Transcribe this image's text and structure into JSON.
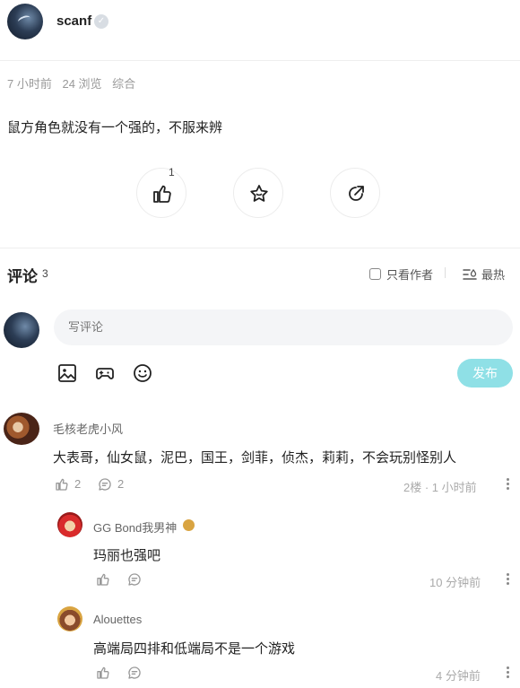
{
  "post": {
    "author": "scanf",
    "time_ago": "7 小时前",
    "views": "24 浏览",
    "category": "综合",
    "content": "鼠方角色就没有一个强的，不服来辨",
    "like_count": "1"
  },
  "comments_section": {
    "title": "评论",
    "count": "3",
    "only_author_label": "只看作者",
    "sort_label": "最热",
    "input_placeholder": "写评论",
    "publish_label": "发布"
  },
  "comments": [
    {
      "author": "毛核老虎小风",
      "text": "大表哥，仙女鼠，泥巴，国王，剑菲，侦杰，莉莉，不会玩别怪别人",
      "likes": "2",
      "replies": "2",
      "floor_time": "2楼 · 1 小时前"
    }
  ],
  "replies": [
    {
      "author": "GG Bond我男神",
      "text": "玛丽也强吧",
      "time": "10 分钟前"
    },
    {
      "author": "Alouettes",
      "text": "高端局四排和低端局不是一个游戏",
      "time": "4 分钟前"
    }
  ],
  "colors": {
    "publish_button": "#8fe0e6",
    "muted_text": "#999999"
  }
}
